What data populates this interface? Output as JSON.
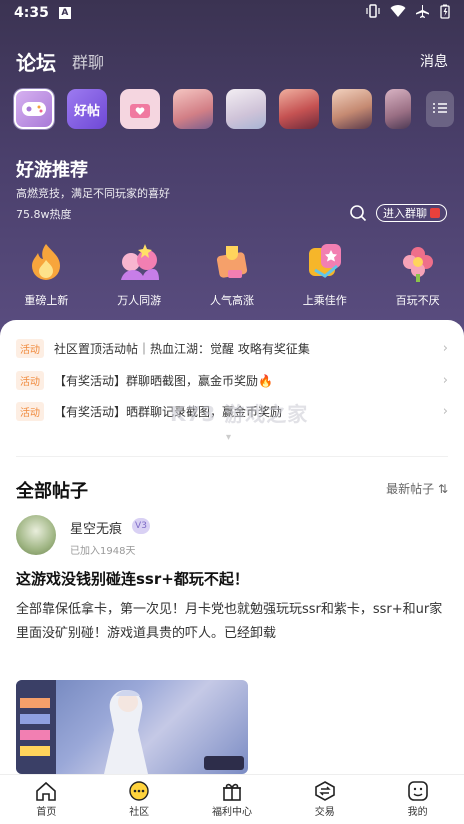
{
  "status": {
    "time": "4:35",
    "a_icon": "A"
  },
  "topnav": {
    "tab_forum": "论坛",
    "tab_group": "群聊",
    "messages": "消息"
  },
  "game_icons": [
    {
      "name": "gamepad-icon",
      "label": "",
      "color": "#c497e6",
      "selected": true
    },
    {
      "name": "haotie-icon",
      "label": "好帖",
      "color": "#8a63e8"
    },
    {
      "name": "heart-hand-icon",
      "label": "",
      "color": "#f07aa0"
    },
    {
      "name": "game-art-1",
      "label": "",
      "color": "#e9a2a6"
    },
    {
      "name": "game-art-2",
      "label": "",
      "color": "#e4dbe6"
    },
    {
      "name": "game-art-3",
      "label": "",
      "color": "#c65a5a"
    },
    {
      "name": "game-art-4",
      "label": "",
      "color": "#d7a58b"
    },
    {
      "name": "game-art-5",
      "label": "",
      "color": "#9a6f84"
    }
  ],
  "recommend": {
    "title": "好游推荐",
    "subtitle": "高燃竞技，满足不同玩家的喜好",
    "heat": "75.8w热度",
    "join_label": "进入群聊"
  },
  "categories": [
    {
      "label": "重磅上新",
      "icon": "fire-icon",
      "color": "#f7a53c"
    },
    {
      "label": "万人同游",
      "icon": "crowd-icon",
      "color": "#f27fb2"
    },
    {
      "label": "人气高涨",
      "icon": "trophy-icon",
      "color": "#f5a06a"
    },
    {
      "label": "上乘佳作",
      "icon": "star-badge-icon",
      "color": "#f6b62a"
    },
    {
      "label": "百玩不厌",
      "icon": "flower-icon",
      "color": "#ef6f8a"
    }
  ],
  "notices": [
    {
      "badge": "活动",
      "text": "社区置顶活动帖｜热血江湖：觉醒 攻略有奖征集"
    },
    {
      "badge": "活动",
      "text": "【有奖活动】群聊晒截图，赢金币奖励🔥"
    },
    {
      "badge": "活动",
      "text": "【有奖活动】晒群聊记录截图，赢金币奖励"
    }
  ],
  "watermark": "K73 游戏之家",
  "section": {
    "title": "全部帖子",
    "sort": "最新帖子 ⇅"
  },
  "post": {
    "author": "星空无痕",
    "level": "V3",
    "joined": "已加入1948天",
    "title": "这游戏没钱别碰连ssr+都玩不起！",
    "body": "全部靠保低拿卡，第一次见！月卡党也就勉强玩玩ssr和紫卡，ssr+和ur家里面没矿别碰！游戏道具贵的吓人。已经卸载"
  },
  "tabbar": [
    {
      "label": "首页",
      "icon": "home-icon"
    },
    {
      "label": "社区",
      "icon": "community-icon"
    },
    {
      "label": "福利中心",
      "icon": "gift-icon"
    },
    {
      "label": "交易",
      "icon": "exchange-icon"
    },
    {
      "label": "我的",
      "icon": "profile-icon"
    }
  ]
}
